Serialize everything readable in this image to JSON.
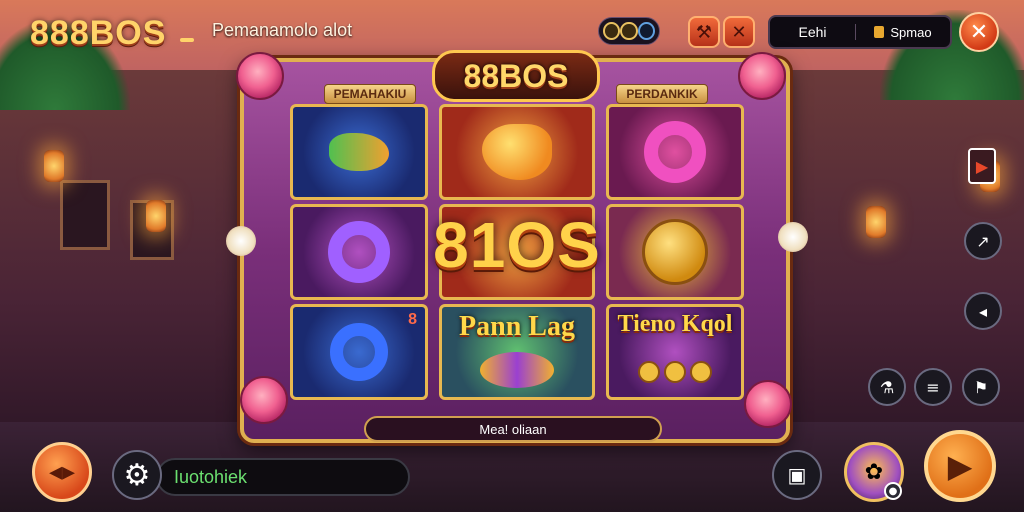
{
  "header": {
    "logo": "888BOS",
    "title": "Pemanamolo alot",
    "balance_label": "Eehi",
    "balance_value": "Spmao"
  },
  "machine": {
    "banner": "88BOS",
    "left_label": "PEMAHAKIU",
    "right_label": "PERDANKIK",
    "center_big": "81OS",
    "caption_middle": "Pann Lag",
    "caption_right": "Tieno Kqol",
    "status": "Mea! oliaan",
    "small_number": "8"
  },
  "bottom": {
    "input_value": "Iuotohiek"
  },
  "icons": {
    "close": "close-icon",
    "settings": "gear-icon",
    "spin": "play-forward-icon",
    "arrows": "left-right-arrows-icon"
  },
  "colors": {
    "accent_orange": "#e8621f",
    "gold": "#ffd24a",
    "text_green": "#6be070"
  }
}
